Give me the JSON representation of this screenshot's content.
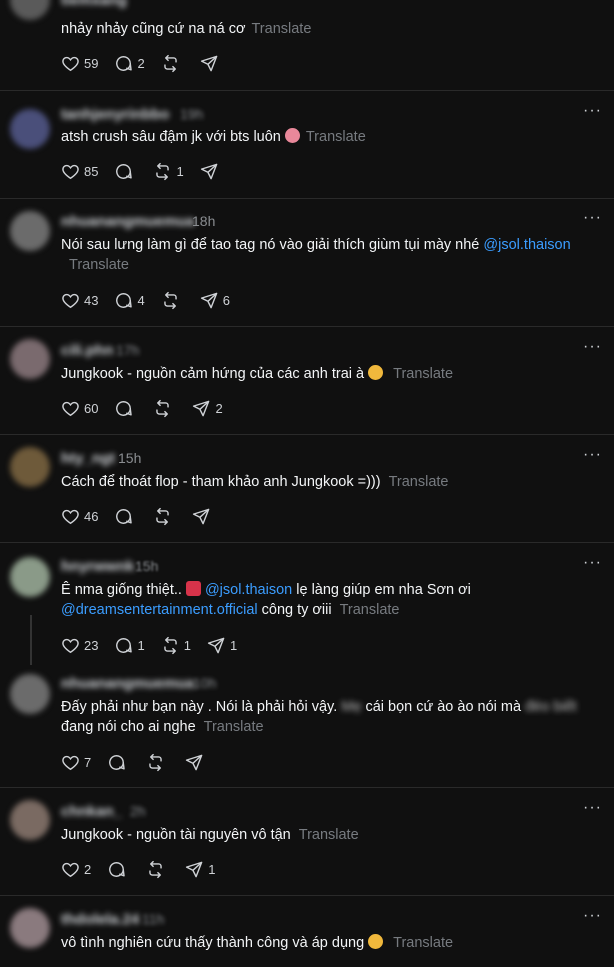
{
  "posts": [
    {
      "username": "tiemxang",
      "time": "",
      "text": "nhảy nhảy cũng cứ na ná cơ",
      "translate": "Translate",
      "likes": "59",
      "replies": "2",
      "reposts": "",
      "shares": ""
    },
    {
      "username": "tanhjenyrinbbo",
      "time": "19h",
      "text": "atsh crush sâu đậm jk với bts luôn",
      "translate": "Translate",
      "likes": "85",
      "replies": "",
      "reposts": "1",
      "shares": ""
    },
    {
      "username": "nhuanangmuemua",
      "time": "18h",
      "text": "Nói sau lưng làm gì để tao tag nó vào giải thích giùm tụi mày nhé",
      "mention": "@jsol.thaison",
      "translate": "Translate",
      "likes": "43",
      "replies": "4",
      "reposts": "",
      "shares": "6"
    },
    {
      "username": "cili.phn",
      "time": "17h",
      "text": "Jungkook - nguồn cảm hứng của các anh trai à",
      "translate": "Translate",
      "likes": "60",
      "replies": "",
      "reposts": "",
      "shares": "2"
    },
    {
      "username": "hty_ngt",
      "time": "15h",
      "text": "Cách để thoát flop - tham khảo anh Jungkook =)))",
      "translate": "Translate",
      "likes": "46",
      "replies": "",
      "reposts": "",
      "shares": ""
    },
    {
      "username": "hnyrwwnk",
      "time": "15h",
      "text_a": "Ê nma giống thiệt..",
      "mention_a": "@jsol.thaison",
      "text_b": "lẹ làng giúp em nha Sơn ơi",
      "mention_b": "@dreamsentertainment.official",
      "text_c": "công ty ơiii",
      "translate": "Translate",
      "likes": "23",
      "replies": "1",
      "reposts": "1",
      "shares": "1"
    },
    {
      "username": "nhuanangmuemua",
      "time": "10h",
      "text_a": "Đấy phải như bạn này . Nói là phải hỏi vậy.",
      "blur_a": "Mẹ",
      "text_b": "cái bọn cứ ào ào nói mà",
      "blur_b": "đéo biết",
      "text_c": "đang nói cho ai nghe",
      "translate": "Translate",
      "likes": "7",
      "replies": "",
      "reposts": "",
      "shares": ""
    },
    {
      "username": "chnkan_",
      "time": "2h",
      "text": "Jungkook - nguồn tài nguyên vô tận",
      "translate": "Translate",
      "likes": "2",
      "replies": "",
      "reposts": "",
      "shares": "1"
    },
    {
      "username": "thdolela.24",
      "time": "11h",
      "text": "vô tình nghiên cứu thấy thành công và áp dụng",
      "translate": "Translate",
      "likes": "",
      "replies": "",
      "reposts": "",
      "shares": ""
    }
  ],
  "colors": {
    "background": "#101010",
    "text": "#f3f5f7",
    "muted": "#777b80",
    "mention": "#3b9dff",
    "divider": "#2a2a2a"
  },
  "icons": {
    "like": "heart-icon",
    "reply": "comment-icon",
    "repost": "repost-icon",
    "share": "send-icon",
    "more": "more-icon"
  }
}
